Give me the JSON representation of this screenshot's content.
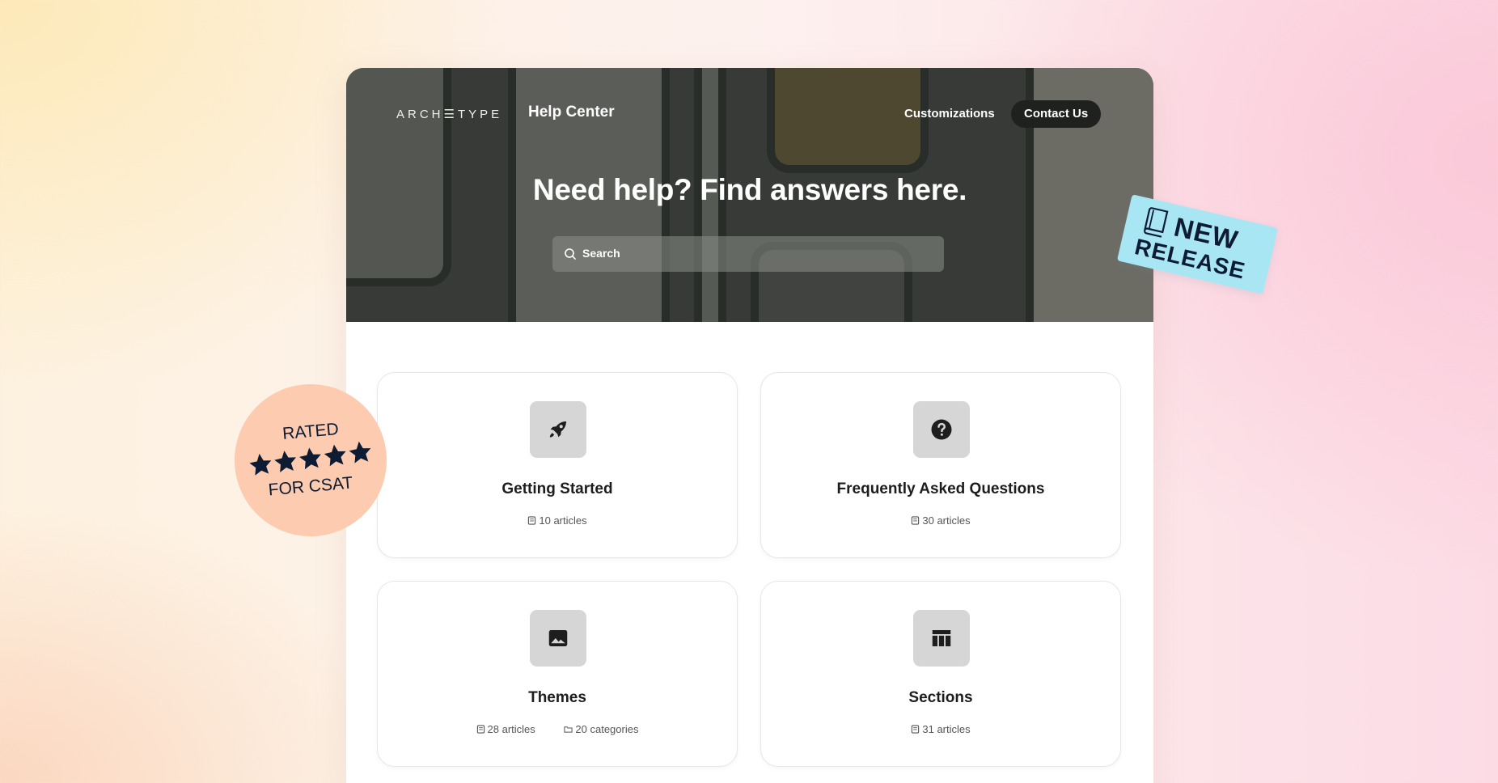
{
  "header": {
    "logo": "ARCH☰TYPE",
    "title": "Help Center",
    "nav_link": "Customizations",
    "contact_button": "Contact Us"
  },
  "hero": {
    "headline": "Need help? Find answers here.",
    "search_placeholder": "Search"
  },
  "categories": [
    {
      "title": "Getting Started",
      "icon": "rocket-icon",
      "articles": "10 articles"
    },
    {
      "title": "Frequently Asked Questions",
      "icon": "question-icon",
      "articles": "30 articles"
    },
    {
      "title": "Themes",
      "icon": "image-icon",
      "articles": "28 articles",
      "categories": "20 categories"
    },
    {
      "title": "Sections",
      "icon": "table-icon",
      "articles": "31 articles"
    }
  ],
  "badges": {
    "rated_top": "RATED",
    "rated_bottom": "FOR CSAT",
    "stars": 5,
    "new_line1": "NEW",
    "new_line2": "RELEASE"
  },
  "colors": {
    "card_icon_bg": "#d6d6d6",
    "rated_badge": "#fccbb0",
    "new_badge": "#a9e6f4",
    "badge_text": "#0d1b33"
  }
}
